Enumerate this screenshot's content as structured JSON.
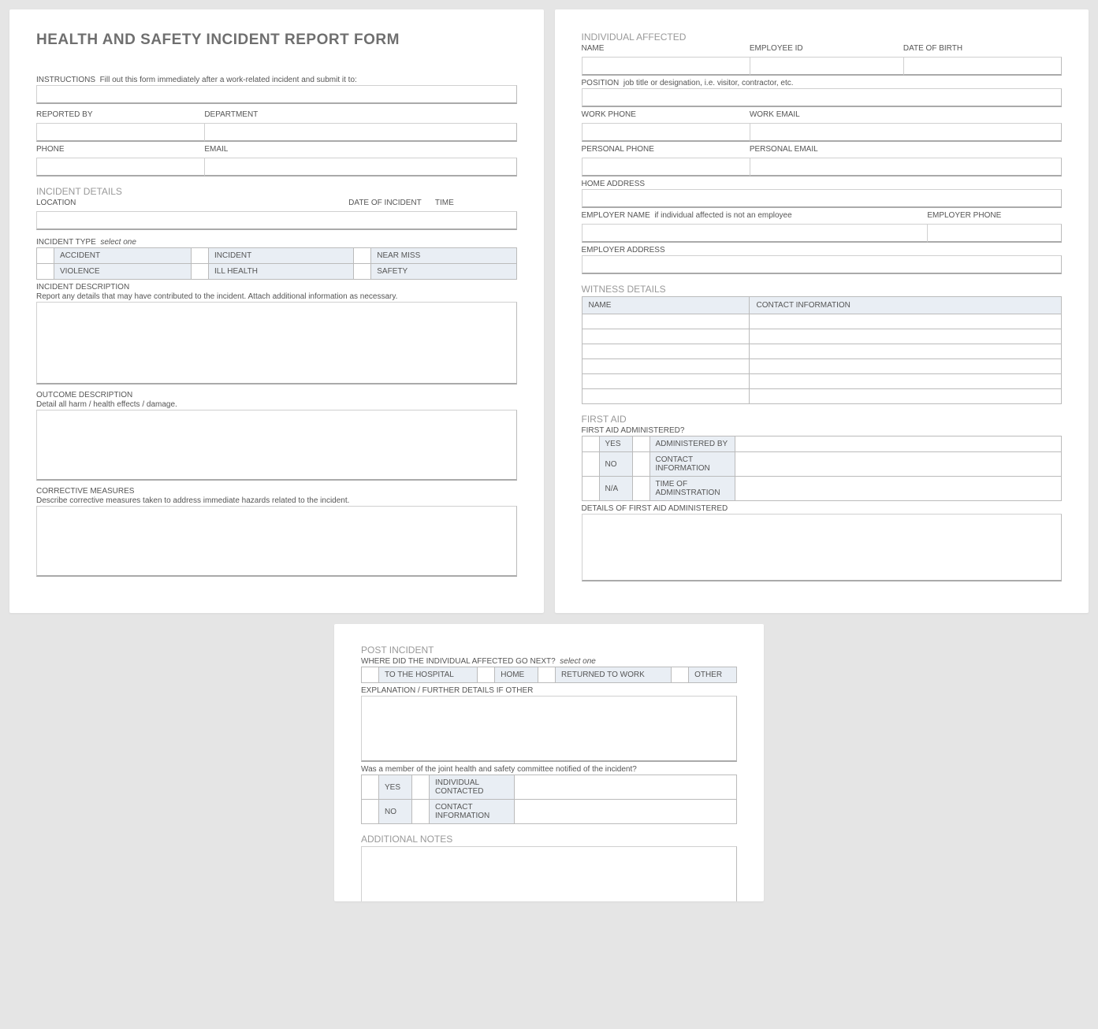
{
  "page1": {
    "title": "HEALTH AND SAFETY INCIDENT REPORT FORM",
    "instructions_label": "INSTRUCTIONS",
    "instructions_hint": "Fill out this form immediately after a work-related incident and submit it to:",
    "reported_by": "REPORTED BY",
    "department": "DEPARTMENT",
    "phone": "PHONE",
    "email": "EMAIL",
    "incident_details": "INCIDENT DETAILS",
    "location": "LOCATION",
    "date_of_incident": "DATE OF INCIDENT",
    "time": "TIME",
    "incident_type": "INCIDENT TYPE",
    "select_one": "select one",
    "types": [
      "ACCIDENT",
      "INCIDENT",
      "NEAR MISS",
      "VIOLENCE",
      "ILL HEALTH",
      "SAFETY"
    ],
    "incident_description": "INCIDENT DESCRIPTION",
    "incident_description_hint": "Report any details that may have contributed to the incident.  Attach additional information as necessary.",
    "outcome_description": "OUTCOME DESCRIPTION",
    "outcome_description_hint": "Detail all harm / health effects / damage.",
    "corrective_measures": "CORRECTIVE MEASURES",
    "corrective_measures_hint": "Describe corrective measures taken to address immediate hazards related to the incident."
  },
  "page2": {
    "individual_affected": "INDIVIDUAL AFFECTED",
    "name": "NAME",
    "employee_id": "EMPLOYEE ID",
    "dob": "DATE OF BIRTH",
    "position": "POSITION",
    "position_hint": "job title or designation, i.e. visitor, contractor, etc.",
    "work_phone": "WORK PHONE",
    "work_email": "WORK EMAIL",
    "personal_phone": "PERSONAL PHONE",
    "personal_email": "PERSONAL EMAIL",
    "home_address": "HOME ADDRESS",
    "employer_name": "EMPLOYER NAME",
    "employer_name_hint": "if individual affected is not an employee",
    "employer_phone": "EMPLOYER PHONE",
    "employer_address": "EMPLOYER ADDRESS",
    "witness_details": "WITNESS DETAILS",
    "wit_name": "NAME",
    "wit_contact": "CONTACT INFORMATION",
    "first_aid": "FIRST AID",
    "first_aid_admin_q": "FIRST AID ADMINISTERED?",
    "yes": "YES",
    "no": "NO",
    "na": "N/A",
    "administered_by": "ADMINISTERED BY",
    "contact_info": "CONTACT INFORMATION",
    "time_admin": "TIME OF ADMINSTRATION",
    "details_first_aid": "DETAILS OF FIRST AID ADMINISTERED"
  },
  "page3": {
    "post_incident": "POST INCIDENT",
    "where_next": "WHERE DID THE INDIVIDUAL AFFECTED GO NEXT?",
    "select_one": "select one",
    "dests": [
      "TO THE HOSPITAL",
      "HOME",
      "RETURNED TO WORK",
      "OTHER"
    ],
    "explanation": "EXPLANATION / FURTHER DETAILS IF OTHER",
    "committee_q": "Was a member of the joint health and safety committee notified of the incident?",
    "yes": "YES",
    "no": "NO",
    "ind_contacted": "INDIVIDUAL CONTACTED",
    "contact_info": "CONTACT INFORMATION",
    "additional_notes": "ADDITIONAL NOTES"
  }
}
